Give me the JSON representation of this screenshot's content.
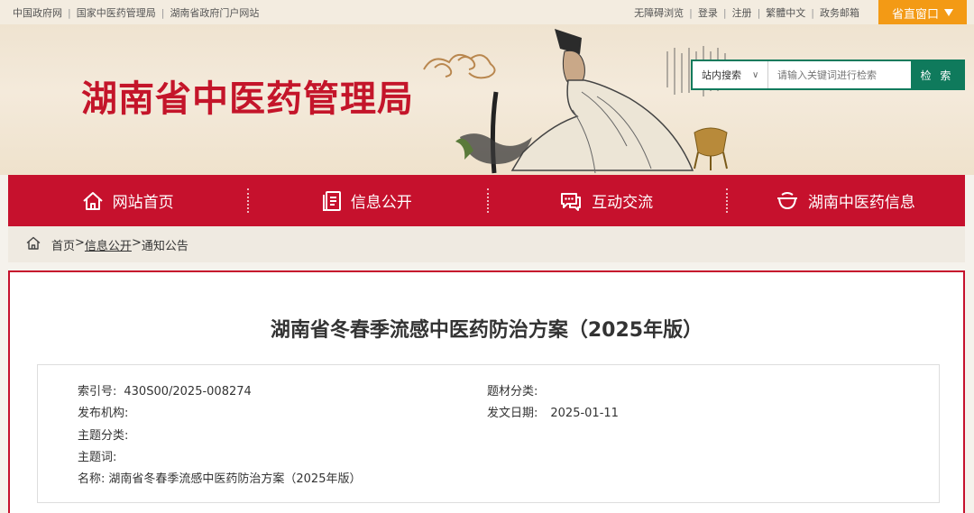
{
  "topbar": {
    "left_links": [
      "中国政府网",
      "国家中医药管理局",
      "湖南省政府门户网站"
    ],
    "right_links": [
      "无障碍浏览",
      "登录",
      "注册",
      "繁體中文",
      "政务邮箱"
    ],
    "portal_label": "省直窗口",
    "portal_icon": "caret-down-icon"
  },
  "banner": {
    "site_title": "湖南省中医药管理局"
  },
  "search": {
    "scope_label": "站内搜索",
    "scope_icon": "chevron-down-icon",
    "placeholder": "请输入关键词进行检索",
    "button_label": "检 索"
  },
  "nav": {
    "items": [
      {
        "label": "网站首页",
        "icon": "home-icon"
      },
      {
        "label": "信息公开",
        "icon": "document-icon"
      },
      {
        "label": "互动交流",
        "icon": "chat-icon"
      },
      {
        "label": "湖南中医药信息",
        "icon": "bowl-icon"
      }
    ]
  },
  "breadcrumb": {
    "home": "首页",
    "sep1": ">",
    "section": "信息公开",
    "sep2": ">",
    "current": "通知公告"
  },
  "article": {
    "title": "湖南省冬春季流感中医药防治方案（2025年版）",
    "meta": {
      "index_label": "索引号:",
      "index_value": "430S00/2025-008274",
      "topic_label": "题材分类:",
      "topic_value": "",
      "org_label": "发布机构:",
      "org_value": "",
      "date_label": "发文日期:",
      "date_value": "2025-01-11",
      "subject_label": "主题分类:",
      "subject_value": "",
      "keywords_label": "主题词:",
      "keywords_value": "",
      "name_label": "名称:",
      "name_value": "湖南省冬春季流感中医药防治方案（2025年版）"
    }
  },
  "colors": {
    "brand_red": "#c6112d",
    "title_red": "#c4152a",
    "search_green": "#0f7a5c",
    "portal_orange": "#f39a15"
  }
}
